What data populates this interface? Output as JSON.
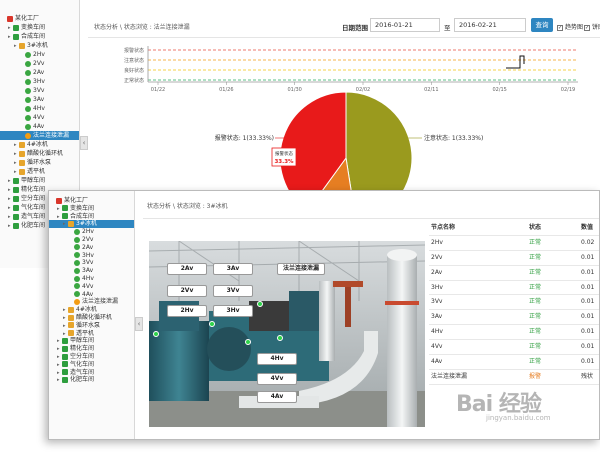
{
  "back_window": {
    "breadcrumb": "状态分析 \\ 状态浏览 : 法兰连接泄漏",
    "tree": [
      {
        "label": "某化工厂",
        "icon": "factory-icon",
        "level": 0
      },
      {
        "label": "变换车间",
        "icon": "plant-icon",
        "level": 1
      },
      {
        "label": "合成车间",
        "icon": "plant-icon",
        "level": 1
      },
      {
        "label": "3#冰机",
        "icon": "folder-icon",
        "level": 2
      },
      {
        "label": "2Hv",
        "icon": "point-icon",
        "level": 3
      },
      {
        "label": "2Vv",
        "icon": "point-icon",
        "level": 3
      },
      {
        "label": "2Av",
        "icon": "point-icon",
        "level": 3
      },
      {
        "label": "3Hv",
        "icon": "point-icon",
        "level": 3
      },
      {
        "label": "3Vv",
        "icon": "point-icon",
        "level": 3
      },
      {
        "label": "3Av",
        "icon": "point-icon",
        "level": 3
      },
      {
        "label": "4Hv",
        "icon": "point-icon",
        "level": 3
      },
      {
        "label": "4Vv",
        "icon": "point-icon",
        "level": 3
      },
      {
        "label": "4Av",
        "icon": "point-icon",
        "level": 3
      },
      {
        "label": "法兰连接泄漏",
        "icon": "alert-icon",
        "level": 3,
        "selected": true
      },
      {
        "label": "4#冰机",
        "icon": "folder-icon",
        "level": 2
      },
      {
        "label": "醋酸化循环机",
        "icon": "folder-icon",
        "level": 2
      },
      {
        "label": "循环水泵",
        "icon": "folder-icon",
        "level": 2
      },
      {
        "label": "透平机",
        "icon": "folder-icon",
        "level": 2
      },
      {
        "label": "甲醇车间",
        "icon": "plant-icon",
        "level": 1
      },
      {
        "label": "精化车间",
        "icon": "plant-icon",
        "level": 1
      },
      {
        "label": "空分车间",
        "icon": "plant-icon",
        "level": 1
      },
      {
        "label": "气化车间",
        "icon": "plant-icon",
        "level": 1
      },
      {
        "label": "造气车间",
        "icon": "plant-icon",
        "level": 1
      },
      {
        "label": "化肥车间",
        "icon": "plant-icon",
        "level": 1
      }
    ],
    "date_label": "日期范围",
    "date_from": "2016-01-21",
    "date_to_label": "至",
    "date_to": "2016-02-21",
    "query_button": "查询",
    "check1": "趋势图",
    "check2": "饼图",
    "colors": {
      "primary": "#2e86c1",
      "selected": "#2e86c1"
    }
  },
  "chart_data": [
    {
      "type": "line",
      "title": "",
      "y_categories": [
        "报警状态",
        "注意状态",
        "良好状态",
        "正常状态"
      ],
      "x_ticks": [
        "01/22",
        "01/26",
        "01/30",
        "02/02",
        "02/11",
        "02/15",
        "02/19"
      ],
      "threshold_colors": [
        "#e74c3c",
        "#f39c12",
        "#f1c40f",
        "#27ae60"
      ]
    },
    {
      "type": "pie",
      "slices": [
        {
          "name": "报警状态",
          "label": "报警状态: 1(33.33%)",
          "value": 33.33,
          "color": "#e81a1a"
        },
        {
          "name": "注意状态",
          "label": "注意状态: 1(33.33%)",
          "value": 33.33,
          "color": "#9a9a1e"
        },
        {
          "name": "",
          "value": 33.33,
          "color": "#e67e22"
        }
      ],
      "tooltip_title": "报警状态",
      "tooltip_value": "33.3%"
    }
  ],
  "front_window": {
    "breadcrumb": "状态分析 \\ 状态浏览 : 3#冰机",
    "tree": [
      {
        "label": "某化工厂",
        "icon": "factory-icon",
        "level": 0
      },
      {
        "label": "变换车间",
        "icon": "plant-icon",
        "level": 1
      },
      {
        "label": "合成车间",
        "icon": "plant-icon",
        "level": 1
      },
      {
        "label": "3#冰机",
        "icon": "folder-icon",
        "level": 2,
        "selected": true
      },
      {
        "label": "2Hv",
        "icon": "point-icon",
        "level": 3
      },
      {
        "label": "2Vv",
        "icon": "point-icon",
        "level": 3
      },
      {
        "label": "2Av",
        "icon": "point-icon",
        "level": 3
      },
      {
        "label": "3Hv",
        "icon": "point-icon",
        "level": 3
      },
      {
        "label": "3Vv",
        "icon": "point-icon",
        "level": 3
      },
      {
        "label": "3Av",
        "icon": "point-icon",
        "level": 3
      },
      {
        "label": "4Hv",
        "icon": "point-icon",
        "level": 3
      },
      {
        "label": "4Vv",
        "icon": "point-icon",
        "level": 3
      },
      {
        "label": "4Av",
        "icon": "point-icon",
        "level": 3
      },
      {
        "label": "法兰连接泄漏",
        "icon": "alert-icon",
        "level": 3
      },
      {
        "label": "4#冰机",
        "icon": "folder-icon",
        "level": 2
      },
      {
        "label": "醋酸化循环机",
        "icon": "folder-icon",
        "level": 2
      },
      {
        "label": "循环水泵",
        "icon": "folder-icon",
        "level": 2
      },
      {
        "label": "透平机",
        "icon": "folder-icon",
        "level": 2
      },
      {
        "label": "甲醇车间",
        "icon": "plant-icon",
        "level": 1
      },
      {
        "label": "精化车间",
        "icon": "plant-icon",
        "level": 1
      },
      {
        "label": "空分车间",
        "icon": "plant-icon",
        "level": 1
      },
      {
        "label": "气化车间",
        "icon": "plant-icon",
        "level": 1
      },
      {
        "label": "造气车间",
        "icon": "plant-icon",
        "level": 1
      },
      {
        "label": "化肥车间",
        "icon": "plant-icon",
        "level": 1
      }
    ],
    "photo_labels": [
      "2Av",
      "3Av",
      "法兰连接泄漏",
      "2Vv",
      "3Vv",
      "2Hv",
      "3Hv",
      "4Hv",
      "4Vv",
      "4Av"
    ],
    "table": {
      "headers": [
        "节点名称",
        "状态",
        "数值"
      ],
      "rows": [
        [
          "2Hv",
          "正常",
          "0.02"
        ],
        [
          "2Vv",
          "正常",
          "0.01"
        ],
        [
          "2Av",
          "正常",
          "0.01"
        ],
        [
          "3Hv",
          "正常",
          "0.01"
        ],
        [
          "3Vv",
          "正常",
          "0.01"
        ],
        [
          "3Av",
          "正常",
          "0.01"
        ],
        [
          "4Hv",
          "正常",
          "0.01"
        ],
        [
          "4Vv",
          "正常",
          "0.01"
        ],
        [
          "4Av",
          "正常",
          "0.01"
        ],
        [
          "法兰连接泄漏",
          "报警",
          "残状"
        ]
      ],
      "status_colors": {
        "正常": "#2e9e3e",
        "报警": "#e67e22"
      }
    }
  },
  "watermark": {
    "text": "Bai 经验",
    "sub": "jingyan.baidu.com"
  }
}
